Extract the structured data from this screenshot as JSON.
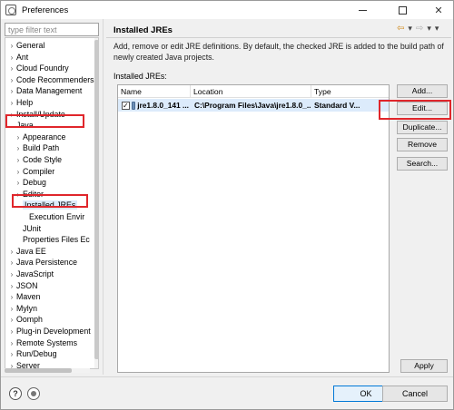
{
  "window": {
    "title": "Preferences",
    "icon": "preferences-app-icon",
    "controls": [
      "minimize",
      "maximize",
      "close"
    ]
  },
  "filter": {
    "placeholder": "type filter text"
  },
  "tree": {
    "items": [
      {
        "label": "General",
        "expanded": false,
        "indent": 0
      },
      {
        "label": "Ant",
        "expanded": false,
        "indent": 0
      },
      {
        "label": "Cloud Foundry",
        "expanded": false,
        "indent": 0
      },
      {
        "label": "Code Recommenders",
        "expanded": false,
        "indent": 0
      },
      {
        "label": "Data Management",
        "expanded": false,
        "indent": 0
      },
      {
        "label": "Help",
        "expanded": false,
        "indent": 0
      },
      {
        "label": "Install/Update",
        "expanded": false,
        "indent": 0
      },
      {
        "label": "Java",
        "expanded": true,
        "indent": 0
      },
      {
        "label": "Appearance",
        "expanded": false,
        "indent": 1
      },
      {
        "label": "Build Path",
        "expanded": false,
        "indent": 1
      },
      {
        "label": "Code Style",
        "expanded": false,
        "indent": 1
      },
      {
        "label": "Compiler",
        "expanded": false,
        "indent": 1
      },
      {
        "label": "Debug",
        "expanded": false,
        "indent": 1
      },
      {
        "label": "Editor",
        "expanded": false,
        "indent": 1
      },
      {
        "label": "Installed JREs",
        "expanded": true,
        "indent": 1,
        "selected": true
      },
      {
        "label": "Execution Envir",
        "expanded": null,
        "indent": 2
      },
      {
        "label": "JUnit",
        "expanded": null,
        "indent": 1
      },
      {
        "label": "Properties Files Ec",
        "expanded": null,
        "indent": 1
      },
      {
        "label": "Java EE",
        "expanded": false,
        "indent": 0
      },
      {
        "label": "Java Persistence",
        "expanded": false,
        "indent": 0
      },
      {
        "label": "JavaScript",
        "expanded": false,
        "indent": 0
      },
      {
        "label": "JSON",
        "expanded": false,
        "indent": 0
      },
      {
        "label": "Maven",
        "expanded": false,
        "indent": 0
      },
      {
        "label": "Mylyn",
        "expanded": false,
        "indent": 0
      },
      {
        "label": "Oomph",
        "expanded": false,
        "indent": 0
      },
      {
        "label": "Plug-in Development",
        "expanded": false,
        "indent": 0
      },
      {
        "label": "Remote Systems",
        "expanded": false,
        "indent": 0
      },
      {
        "label": "Run/Debug",
        "expanded": false,
        "indent": 0
      },
      {
        "label": "Server",
        "expanded": false,
        "indent": 0
      }
    ]
  },
  "page": {
    "title": "Installed JREs",
    "description": "Add, remove or edit JRE definitions. By default, the checked JRE is added to the build path of newly created Java projects.",
    "installed_label": "Installed JREs:"
  },
  "table": {
    "columns": [
      "Name",
      "Location",
      "Type"
    ],
    "rows": [
      {
        "checked": true,
        "name": "jre1.8.0_141 ...",
        "location": "C:\\Program Files\\Java\\jre1.8.0_...",
        "type": "Standard V..."
      }
    ]
  },
  "buttons": {
    "add": "Add...",
    "edit": "Edit...",
    "duplicate": "Duplicate...",
    "remove": "Remove",
    "search": "Search...",
    "apply": "Apply",
    "ok": "OK",
    "cancel": "Cancel"
  },
  "glyphs": {
    "chevron_right": "›",
    "chevron_down": "⌄",
    "check": "✓",
    "back": "⇦",
    "forward": "⇨",
    "menu": "▾",
    "help": "?"
  },
  "highlight_color": "#e0262b",
  "selection_color": "#dcebfb"
}
